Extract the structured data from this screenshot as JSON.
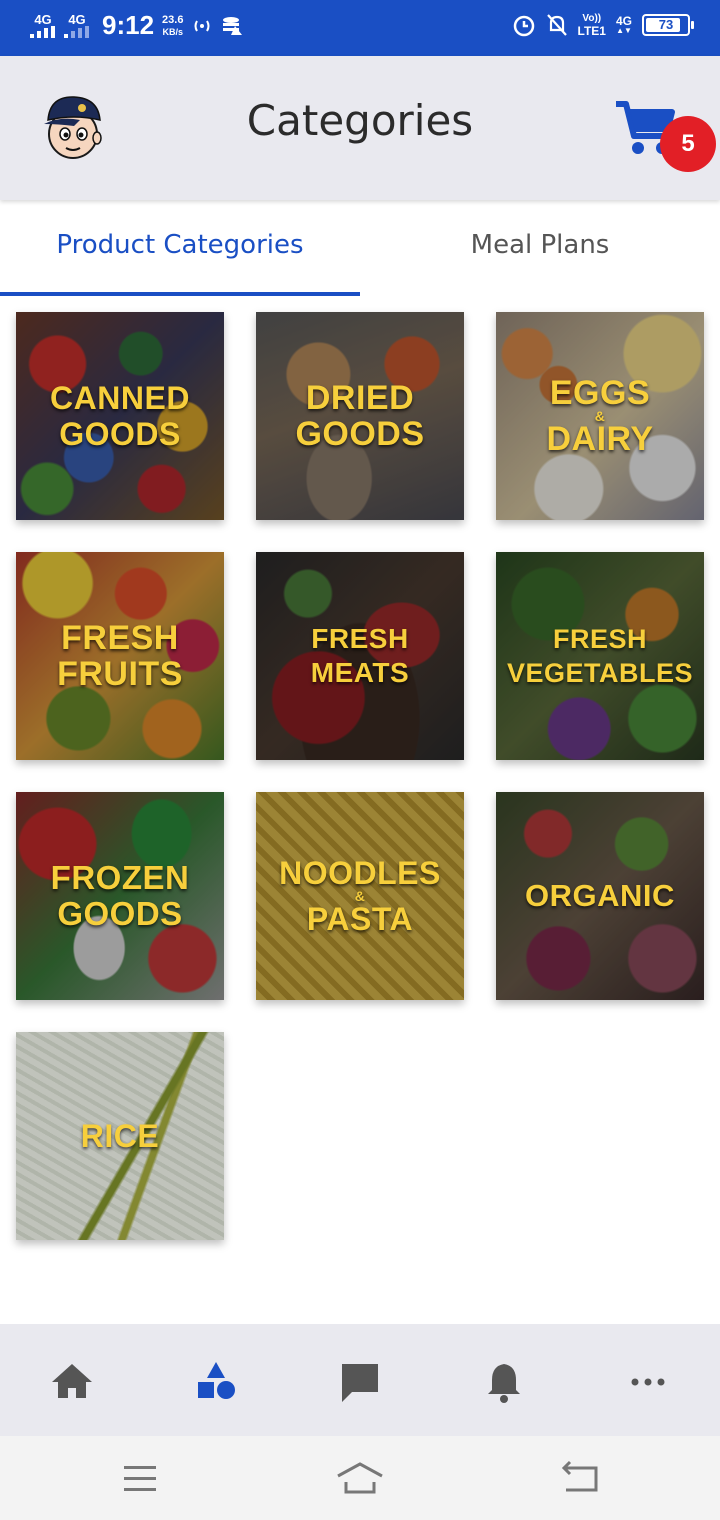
{
  "status_bar": {
    "network_1": "4G",
    "network_2": "4G",
    "time": "9:12",
    "speed_value": "23.6",
    "speed_unit": "KB/s",
    "volte_top": "Vo))",
    "volte_bottom": "LTE1",
    "network_right": "4G",
    "battery": "73"
  },
  "header": {
    "title": "Categories",
    "cart_count": "5"
  },
  "tabs": [
    {
      "label": "Product Categories",
      "active": true
    },
    {
      "label": "Meal Plans",
      "active": false
    }
  ],
  "categories": [
    {
      "line1": "CANNED",
      "line2": "GOODS"
    },
    {
      "line1": "DRIED",
      "line2": "GOODS"
    },
    {
      "line1": "EGGS",
      "amp": "&",
      "line2": "DAIRY"
    },
    {
      "line1": "FRESH",
      "line2": "FRUITS"
    },
    {
      "line1": "FRESH",
      "line2": "MEATS"
    },
    {
      "line1": "FRESH",
      "line2": "VEGETABLES"
    },
    {
      "line1": "FROZEN",
      "line2": "GOODS"
    },
    {
      "line1": "NOODLES",
      "amp": "&",
      "line2": "PASTA"
    },
    {
      "line1": "ORGANIC"
    },
    {
      "line1": "RICE"
    }
  ],
  "bottom_nav": [
    {
      "icon": "home-icon",
      "active": false
    },
    {
      "icon": "categories-icon",
      "active": true
    },
    {
      "icon": "chat-icon",
      "active": false
    },
    {
      "icon": "bell-icon",
      "active": false
    },
    {
      "icon": "more-icon",
      "active": false
    }
  ],
  "colors": {
    "primary": "#1a4fc4",
    "badge": "#e21f26",
    "label": "#f7cf3c"
  }
}
